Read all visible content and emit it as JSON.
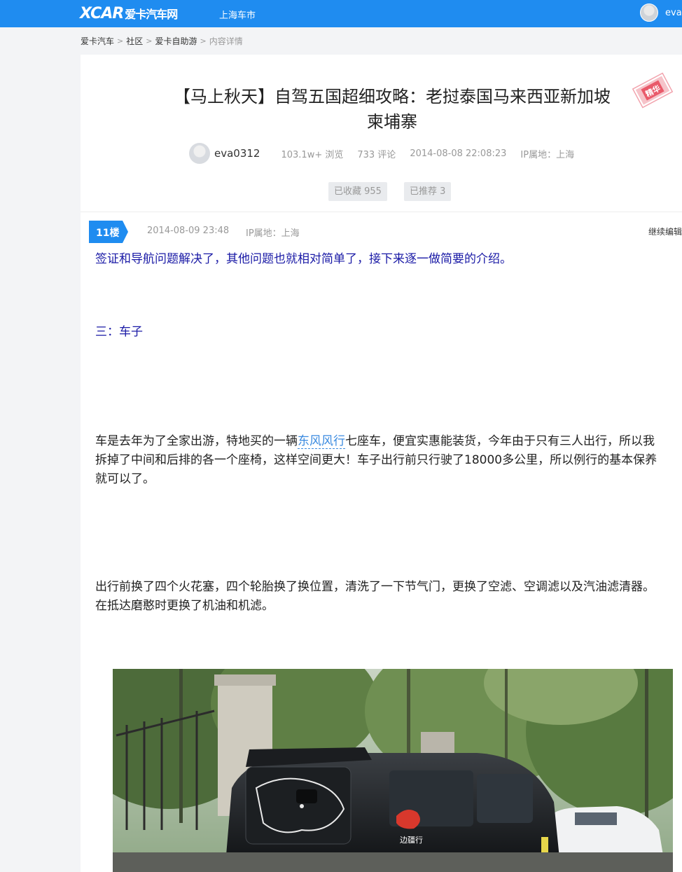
{
  "topnav": {
    "logo_mark": "XCAR",
    "logo_text": "爱卡汽车网",
    "city": "上海车市",
    "username": "eva",
    "bg_color": "#1f8cf0"
  },
  "breadcrumb": [
    "爱卡汽车",
    "社区",
    "爱卡自助游",
    "内容详情"
  ],
  "post": {
    "title_line1": "【马上秋天】自驾五国超细攻略：老挝泰国马来西亚新加坡",
    "title_line2": "柬埔寨",
    "badge": "精华",
    "author": "eva0312",
    "views": "103.1w+ 浏览",
    "comments": "733 评论",
    "datetime": "2014-08-08 22:08:23",
    "ip": "IP属地：上海",
    "favorited": "已收藏 955",
    "recommended": "已推荐 3"
  },
  "floor": {
    "number": "11楼",
    "datetime": "2014-08-09 23:48",
    "ip": "IP属地：上海",
    "continue_edit": "继续编辑"
  },
  "content": {
    "p1": "签证和导航问题解决了，其他问题也就相对简单了，接下来逐一做简要的介绍。",
    "p2": "三：车子",
    "p3_before": "车是去年为了全家出游，特地买的一辆",
    "p3_link": "东风风行",
    "p3_after": "七座车，便宜实惠能装货，今年由于只有三人出行，所以我",
    "p3_line2": "拆掉了中间和后排的各一个座椅，这样空间更大！车子出行前只行驶了18000多公里，所以例行的基本保养",
    "p3_line3": "就可以了。",
    "p4_line1": "出行前换了四个火花塞，四个轮胎换了换位置，清洗了一下节气门，更换了空滤、空调滤以及汽油滤清器。",
    "p4_line2": "在抵达磨憨时更换了机油和机滤。",
    "photo_sticker": "边疆行"
  }
}
